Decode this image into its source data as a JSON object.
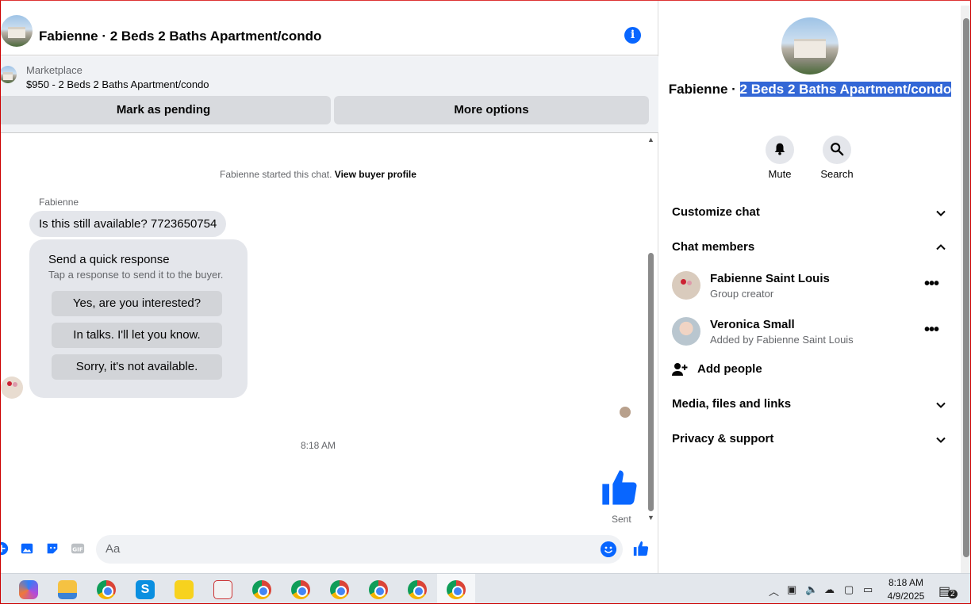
{
  "chat": {
    "title": "Fabienne · 2 Beds 2 Baths Apartment/condo",
    "marketplace_label": "Marketplace",
    "listing": "$950 - 2 Beds 2 Baths Apartment/condo",
    "mark_pending": "Mark as pending",
    "more_options": "More options",
    "started_prefix": "Fabienne started this chat.",
    "view_profile": "View buyer profile",
    "sender": "Fabienne",
    "message": "Is this still available? 7723650754",
    "quick_title": "Send a quick response",
    "quick_sub": "Tap a response to send it to the buyer.",
    "quick_responses": [
      "Yes, are you interested?",
      "In talks. I'll let you know.",
      "Sorry, it's not available."
    ],
    "time": "8:18 AM",
    "sent": "Sent",
    "composer_placeholder": "Aa"
  },
  "panel": {
    "title_plain": "Fabienne · ",
    "title_selected": "2 Beds 2 Baths Apartment/condo",
    "mute": "Mute",
    "search": "Search",
    "customize": "Customize chat",
    "members_header": "Chat members",
    "members": [
      {
        "name": "Fabienne Saint Louis",
        "sub": "Group creator"
      },
      {
        "name": "Veronica Small",
        "sub": "Added by Fabienne Saint Louis"
      }
    ],
    "add_people": "Add people",
    "media": "Media, files and links",
    "privacy": "Privacy & support"
  },
  "taskbar": {
    "time": "8:18 AM",
    "date": "4/9/2025",
    "notifications": "2"
  },
  "colors": {
    "accent": "#0866ff",
    "selection": "#3367d6",
    "bubble": "#e4e6eb"
  }
}
